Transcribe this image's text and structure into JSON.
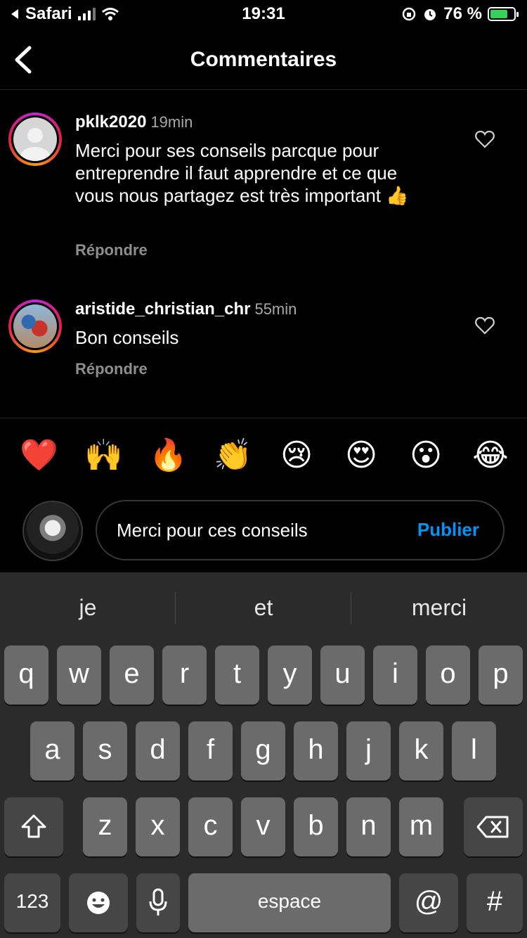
{
  "status_bar": {
    "back_app": "Safari",
    "time": "19:31",
    "battery_percent": "76 %",
    "battery_level": 0.76
  },
  "header": {
    "title": "Commentaires"
  },
  "comments": [
    {
      "username": "pklk2020",
      "time": "19min",
      "text": "Merci pour ses conseils parcque pour entreprendre il faut apprendre et ce que vous nous partagez est très important 👍",
      "reply_label": "Répondre"
    },
    {
      "username": "aristide_christian_chr",
      "time": "55min",
      "text": "Bon conseils",
      "reply_label": "Répondre"
    }
  ],
  "reactions": [
    "❤️",
    "🙌",
    "🔥",
    "👏",
    "😢",
    "😍",
    "😮",
    "😂"
  ],
  "composer": {
    "value": "Merci pour ces conseils",
    "publish_label": "Publier"
  },
  "keyboard": {
    "suggestions": [
      "je",
      "et",
      "merci"
    ],
    "row1": [
      "q",
      "w",
      "e",
      "r",
      "t",
      "y",
      "u",
      "i",
      "o",
      "p"
    ],
    "row2": [
      "a",
      "s",
      "d",
      "f",
      "g",
      "h",
      "j",
      "k",
      "l"
    ],
    "row3": [
      "z",
      "x",
      "c",
      "v",
      "b",
      "n",
      "m"
    ],
    "numbers_label": "123",
    "space_label": "espace",
    "at_label": "@",
    "hash_label": "#"
  },
  "icons": {
    "back": "chevron-left-icon",
    "heart": "heart-outline-icon",
    "shift": "shift-icon",
    "delete": "backspace-icon",
    "emoji": "emoji-icon",
    "mic": "microphone-icon"
  },
  "colors": {
    "accent": "#0095f6",
    "background": "#000000",
    "keyboard": "#2b2b2b"
  }
}
